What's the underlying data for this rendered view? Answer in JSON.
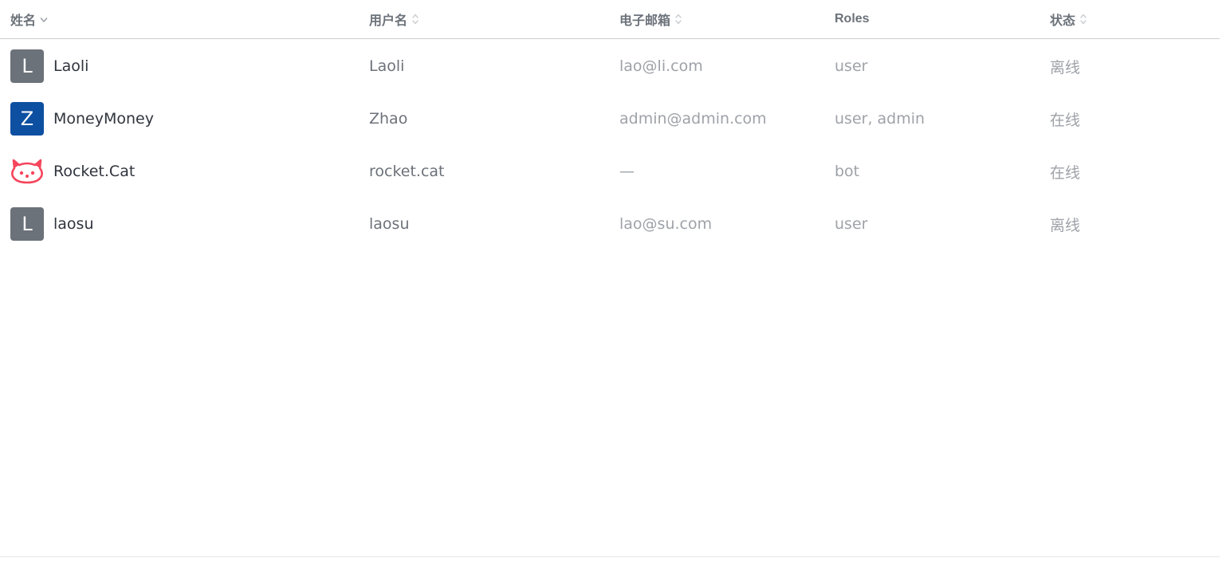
{
  "table": {
    "columns": [
      {
        "key": "name",
        "label": "姓名",
        "sortable": true,
        "sort": "desc"
      },
      {
        "key": "username",
        "label": "用户名",
        "sortable": true,
        "sort": "none"
      },
      {
        "key": "email",
        "label": "电子邮箱",
        "sortable": true,
        "sort": "none"
      },
      {
        "key": "roles",
        "label": "Roles",
        "sortable": false
      },
      {
        "key": "status",
        "label": "状态",
        "sortable": true,
        "sort": "none"
      }
    ],
    "rows": [
      {
        "avatar_letter": "L",
        "avatar_color": "#6c727a",
        "avatar_icon": "",
        "name": "Laoli",
        "username": "Laoli",
        "email": "lao@li.com",
        "roles": "user",
        "status": "离线"
      },
      {
        "avatar_letter": "Z",
        "avatar_color": "#0d4fa1",
        "avatar_icon": "",
        "name": "MoneyMoney",
        "username": "Zhao",
        "email": "admin@admin.com",
        "roles": "user, admin",
        "status": "在线"
      },
      {
        "avatar_letter": "",
        "avatar_color": "#f5455c",
        "avatar_icon": "rocket-cat-icon",
        "name": "Rocket.Cat",
        "username": "rocket.cat",
        "email": "—",
        "roles": "bot",
        "status": "在线"
      },
      {
        "avatar_letter": "L",
        "avatar_color": "#6c727a",
        "avatar_icon": "",
        "name": "laosu",
        "username": "laosu",
        "email": "lao@su.com",
        "roles": "user",
        "status": "离线"
      }
    ]
  },
  "colors": {
    "header_text": "#6c727a",
    "name_text": "#2f343d",
    "secondary_text": "#6c727a",
    "muted_text": "#9ea2a8",
    "divider": "#cbced1"
  }
}
